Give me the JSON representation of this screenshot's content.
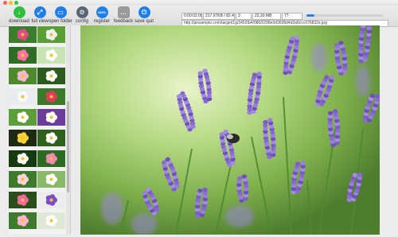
{
  "toolbar": {
    "download": "download",
    "full_view": "full view",
    "open_folder": "open folder",
    "config": "config",
    "register": "register",
    "feedback": "feedback",
    "save_quit": "save quit",
    "register_badge": "100%"
  },
  "status": {
    "time": "0:00:02:08",
    "speed": "217.97KB / 82.40KB",
    "count": "3",
    "size": "22.30 MB",
    "items": "77",
    "progress": 0.1,
    "url": "http://pixsample.com/target/1g/345/0b4/086/0298e0d3608d4d3a8ccc076832e.jpg"
  },
  "colors": {
    "accent_blue": "#1f7fe8",
    "download_green": "#2fbd3f",
    "lavender": "#8a6bd1"
  }
}
